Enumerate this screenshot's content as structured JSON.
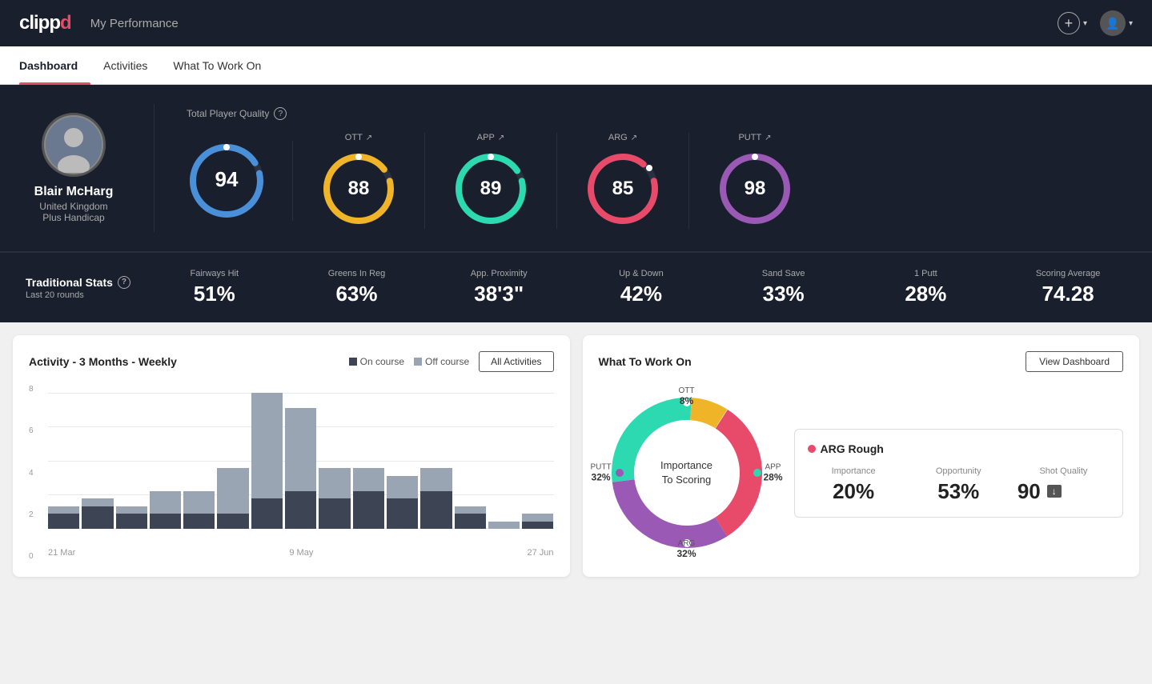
{
  "header": {
    "logo_clip": "clipp",
    "logo_pd": "d",
    "title": "My Performance",
    "add_label": "",
    "avatar_label": ""
  },
  "nav": {
    "tabs": [
      {
        "id": "dashboard",
        "label": "Dashboard",
        "active": true
      },
      {
        "id": "activities",
        "label": "Activities",
        "active": false
      },
      {
        "id": "what-to-work-on",
        "label": "What To Work On",
        "active": false
      }
    ]
  },
  "player": {
    "name": "Blair McHarg",
    "country": "United Kingdom",
    "handicap": "Plus Handicap"
  },
  "quality": {
    "section_label": "Total Player Quality",
    "main_score": 94,
    "main_color": "#4a90d9",
    "gauges": [
      {
        "id": "ott",
        "label": "OTT",
        "score": 88,
        "color": "#f0b429",
        "trend": "↗"
      },
      {
        "id": "app",
        "label": "APP",
        "score": 89,
        "color": "#2dd9b0",
        "trend": "↗"
      },
      {
        "id": "arg",
        "label": "ARG",
        "score": 85,
        "color": "#e84b6a",
        "trend": "↗"
      },
      {
        "id": "putt",
        "label": "PUTT",
        "score": 98,
        "color": "#9b59b6",
        "trend": "↗"
      }
    ]
  },
  "trad_stats": {
    "title": "Traditional Stats",
    "subtitle": "Last 20 rounds",
    "stats": [
      {
        "id": "fairways",
        "label": "Fairways Hit",
        "value": "51%"
      },
      {
        "id": "greens",
        "label": "Greens In Reg",
        "value": "63%"
      },
      {
        "id": "proximity",
        "label": "App. Proximity",
        "value": "38'3\""
      },
      {
        "id": "updown",
        "label": "Up & Down",
        "value": "42%"
      },
      {
        "id": "sandsave",
        "label": "Sand Save",
        "value": "33%"
      },
      {
        "id": "oneputt",
        "label": "1 Putt",
        "value": "28%"
      },
      {
        "id": "scoring",
        "label": "Scoring Average",
        "value": "74.28"
      }
    ]
  },
  "activity_chart": {
    "title": "Activity - 3 Months - Weekly",
    "legend_on": "On course",
    "legend_off": "Off course",
    "btn_label": "All Activities",
    "y_labels": [
      "8",
      "6",
      "4",
      "2",
      "0"
    ],
    "x_labels": [
      "21 Mar",
      "9 May",
      "27 Jun"
    ],
    "bars": [
      {
        "on": 1,
        "off": 0.5
      },
      {
        "on": 1.5,
        "off": 0.5
      },
      {
        "on": 1,
        "off": 0.5
      },
      {
        "on": 1,
        "off": 1.5
      },
      {
        "on": 1,
        "off": 1.5
      },
      {
        "on": 1,
        "off": 3
      },
      {
        "on": 2,
        "off": 7
      },
      {
        "on": 2.5,
        "off": 5.5
      },
      {
        "on": 2,
        "off": 2
      },
      {
        "on": 2.5,
        "off": 1.5
      },
      {
        "on": 2,
        "off": 1.5
      },
      {
        "on": 2.5,
        "off": 1.5
      },
      {
        "on": 1,
        "off": 0.5
      },
      {
        "on": 0,
        "off": 0.5
      },
      {
        "on": 0.5,
        "off": 0.5
      }
    ],
    "max_value": 9
  },
  "workon": {
    "title": "What To Work On",
    "btn_label": "View Dashboard",
    "donut_center": "Importance\nTo Scoring",
    "segments": [
      {
        "id": "ott",
        "label": "OTT",
        "pct": "8%",
        "color": "#f0b429",
        "value": 8
      },
      {
        "id": "app",
        "label": "APP",
        "pct": "28%",
        "color": "#2dd9b0",
        "value": 28
      },
      {
        "id": "arg",
        "label": "ARG",
        "pct": "32%",
        "color": "#e84b6a",
        "value": 32
      },
      {
        "id": "putt",
        "label": "PUTT",
        "pct": "32%",
        "color": "#9b59b6",
        "value": 32
      }
    ],
    "detail": {
      "title": "ARG Rough",
      "dot_color": "#e84b6a",
      "metrics": [
        {
          "id": "importance",
          "label": "Importance",
          "value": "20%"
        },
        {
          "id": "opportunity",
          "label": "Opportunity",
          "value": "53%"
        },
        {
          "id": "shot_quality",
          "label": "Shot Quality",
          "value": "90",
          "badge": "↓"
        }
      ]
    }
  }
}
